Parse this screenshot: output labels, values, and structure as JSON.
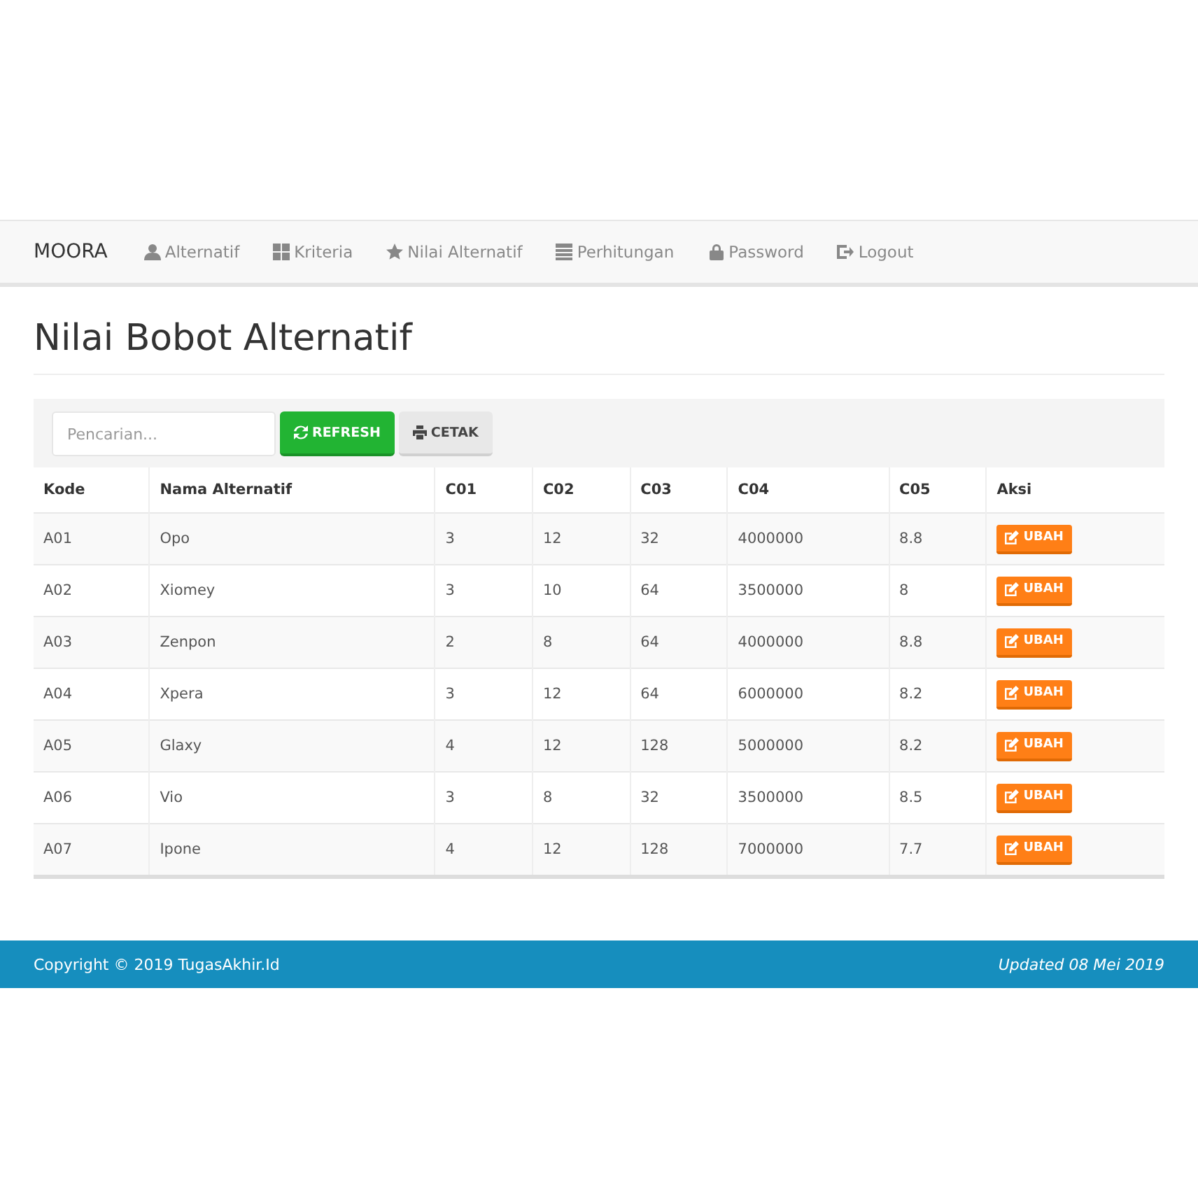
{
  "navbar": {
    "brand": "MOORA",
    "items": [
      {
        "kind": "user",
        "label": "Alternatif"
      },
      {
        "kind": "grid",
        "label": "Kriteria"
      },
      {
        "kind": "star",
        "label": "Nilai Alternatif"
      },
      {
        "kind": "list",
        "label": "Perhitungan"
      },
      {
        "kind": "lock",
        "label": "Password"
      },
      {
        "kind": "logout",
        "label": "Logout"
      }
    ]
  },
  "page_title": "Nilai Bobot Alternatif",
  "toolbar": {
    "search": {
      "placeholder": "Pencarian..."
    },
    "buttons": [
      {
        "kind": "refresh",
        "label": "REFRESH"
      },
      {
        "kind": "print",
        "label": "CETAK"
      }
    ]
  },
  "table": {
    "columns": [
      "Kode",
      "Nama Alternatif",
      "C01",
      "C02",
      "C03",
      "C04",
      "C05",
      "Aksi"
    ],
    "rows": [
      {
        "cells": [
          "A01",
          "Opo",
          "3",
          "12",
          "32",
          "4000000",
          "8.8"
        ],
        "action": "UBAH"
      },
      {
        "cells": [
          "A02",
          "Xiomey",
          "3",
          "10",
          "64",
          "3500000",
          "8"
        ],
        "action": "UBAH"
      },
      {
        "cells": [
          "A03",
          "Zenpon",
          "2",
          "8",
          "64",
          "4000000",
          "8.8"
        ],
        "action": "UBAH"
      },
      {
        "cells": [
          "A04",
          "Xpera",
          "3",
          "12",
          "64",
          "6000000",
          "8.2"
        ],
        "action": "UBAH"
      },
      {
        "cells": [
          "A05",
          "Glaxy",
          "4",
          "12",
          "128",
          "5000000",
          "8.2"
        ],
        "action": "UBAH"
      },
      {
        "cells": [
          "A06",
          "Vio",
          "3",
          "8",
          "32",
          "3500000",
          "8.5"
        ],
        "action": "UBAH"
      },
      {
        "cells": [
          "A07",
          "Ipone",
          "4",
          "12",
          "128",
          "7000000",
          "7.7"
        ],
        "action": "UBAH"
      }
    ]
  },
  "footer": {
    "copyright": "Copyright © 2019 TugasAkhir.Id",
    "updated": "Updated 08 Mei 2019"
  }
}
